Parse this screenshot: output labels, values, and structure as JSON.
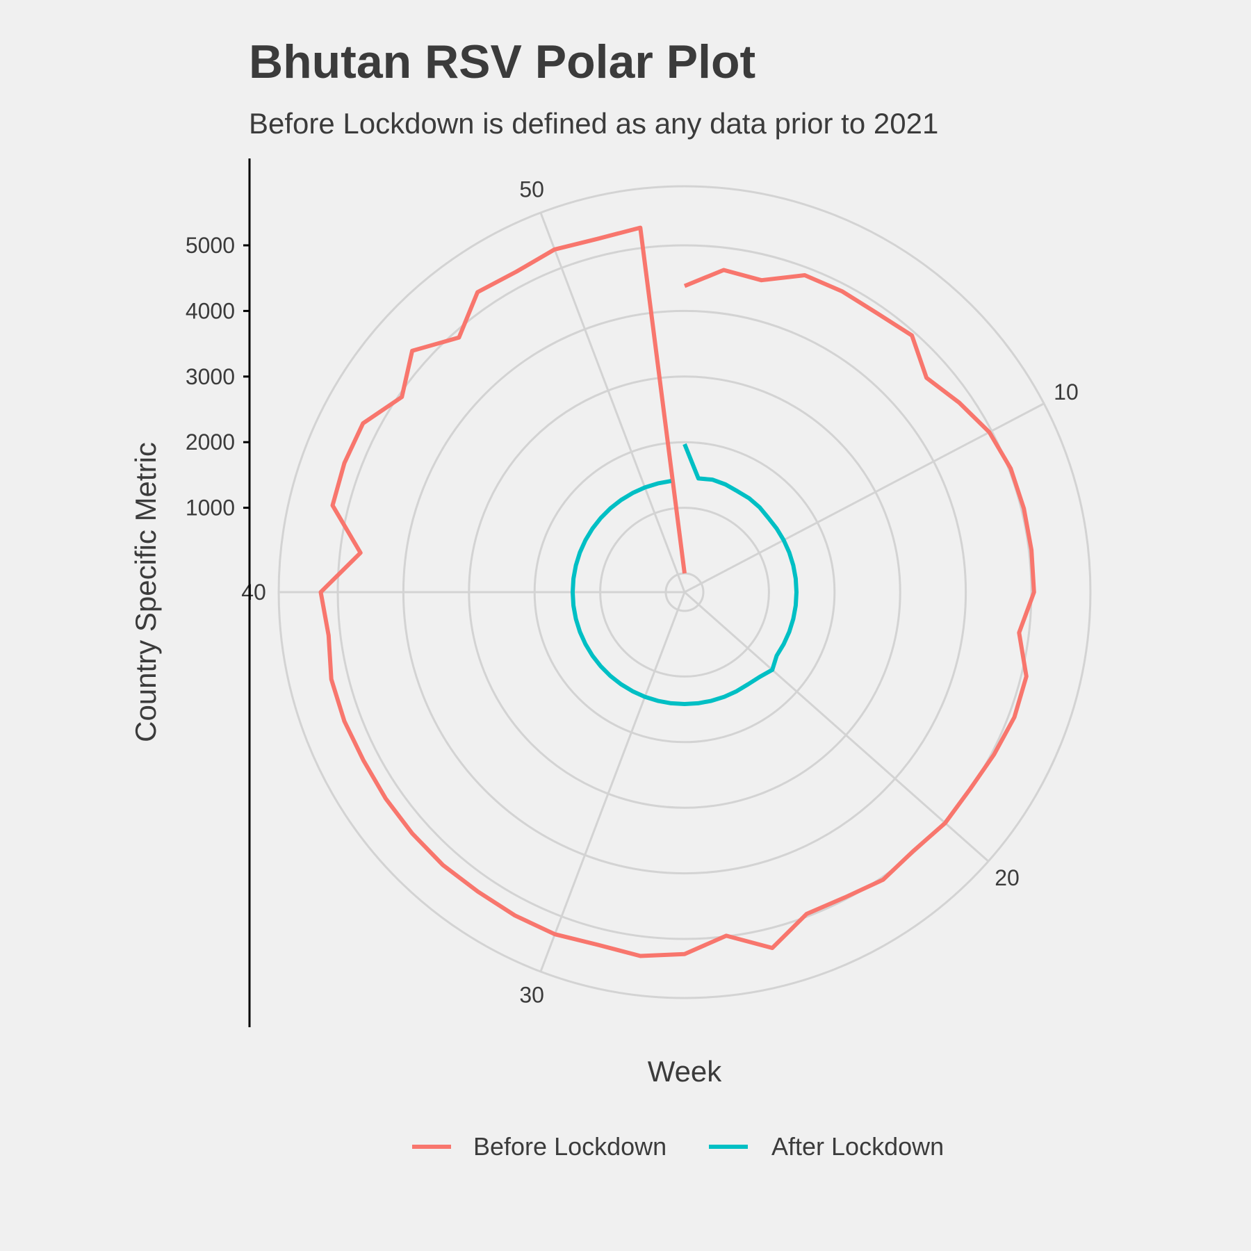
{
  "chart_data": {
    "type": "line",
    "coordinate_system": "polar",
    "title": "Bhutan RSV Polar Plot",
    "subtitle": "Before Lockdown is defined as any data prior to 2021",
    "xlabel": "Week",
    "ylabel": "Country Specific Metric",
    "x_ticks": [
      "10",
      "20",
      "30",
      "40",
      "50"
    ],
    "y_ticks": [
      "1000",
      "2000",
      "3000",
      "4000",
      "5000"
    ],
    "xlim": [
      1,
      53
    ],
    "ylim": [
      0,
      5900
    ],
    "grid": true,
    "legend_position": "bottom",
    "colors": {
      "before": "#f8766d",
      "after": "#00bfc4",
      "grid": "#d3d3d3",
      "background": "#f0f0f0",
      "text": "#3b3b3b"
    },
    "series": [
      {
        "name": "Before Lockdown",
        "color": "#f8766d",
        "x": [
          1,
          2,
          3,
          4,
          5,
          6,
          7,
          8,
          9,
          10,
          11,
          12,
          13,
          14,
          15,
          16,
          17,
          18,
          19,
          20,
          21,
          22,
          23,
          24,
          25,
          26,
          27,
          28,
          29,
          30,
          31,
          32,
          33,
          34,
          35,
          36,
          37,
          38,
          39,
          40,
          41,
          42,
          43,
          44,
          45,
          46,
          47,
          48,
          49,
          50,
          51,
          52,
          53
        ],
        "y": [
          4380,
          4660,
          4610,
          4880,
          4890,
          4880,
          4940,
          4640,
          4800,
          4960,
          5030,
          5040,
          5040,
          5040,
          4850,
          5080,
          5090,
          5040,
          5000,
          5020,
          4980,
          5040,
          4970,
          4960,
          5300,
          4990,
          5230,
          5300,
          5250,
          5290,
          5280,
          5260,
          5270,
          5260,
          5250,
          5240,
          5260,
          5260,
          5180,
          5260,
          4690,
          5240,
          5260,
          5250,
          4950,
          5260,
          4900,
          5270,
          5230,
          5300,
          5260,
          5310,
          0
        ]
      },
      {
        "name": "After Lockdown",
        "color": "#00bfc4",
        "x": [
          1,
          2,
          3,
          4,
          5,
          6,
          7,
          8,
          9,
          10,
          11,
          12,
          13,
          14,
          15,
          16,
          17,
          18,
          19,
          20,
          21,
          22,
          23,
          24,
          25,
          26,
          27,
          28,
          29,
          30,
          31,
          32,
          33,
          34,
          35,
          36,
          37,
          38,
          39,
          40,
          41,
          42,
          43,
          44,
          45,
          46,
          47,
          48,
          49,
          50,
          51,
          52
        ],
        "y": [
          1970,
          1460,
          1480,
          1470,
          1450,
          1450,
          1440,
          1420,
          1420,
          1420,
          1420,
          1420,
          1420,
          1420,
          1420,
          1420,
          1420,
          1420,
          1420,
          1500,
          1440,
          1420,
          1420,
          1420,
          1420,
          1420,
          1420,
          1420,
          1420,
          1420,
          1420,
          1420,
          1420,
          1420,
          1420,
          1420,
          1420,
          1420,
          1420,
          1420,
          1420,
          1420,
          1420,
          1420,
          1420,
          1420,
          1420,
          1420,
          1420,
          1420,
          1420,
          1420
        ]
      }
    ]
  }
}
